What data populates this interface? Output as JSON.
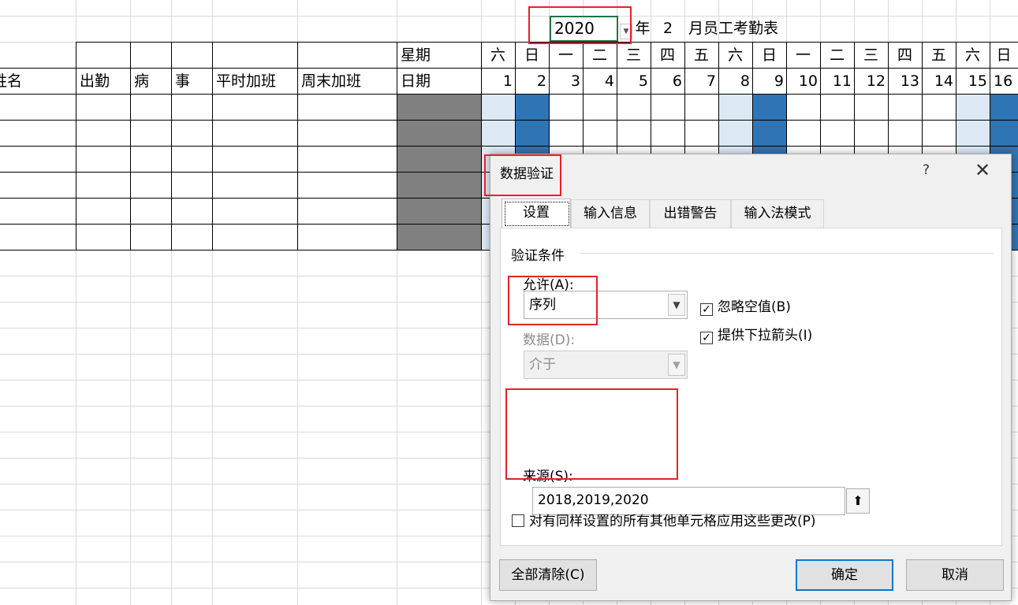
{
  "sheet": {
    "title_cells": {
      "year": "2020",
      "year_suffix": "年",
      "month": "2",
      "title": "月员工考勤表"
    },
    "header_row1": {
      "weekday_label": "星期"
    },
    "header_row2": {
      "name": "姓名",
      "attendance": "出勤",
      "sick": "病",
      "personal": "事",
      "weekday_overtime": "平时加班",
      "weekend_overtime": "周末加班",
      "date_label": "日期"
    },
    "weekdays": [
      "六",
      "日",
      "一",
      "二",
      "三",
      "四",
      "五",
      "六",
      "日",
      "一",
      "二",
      "三",
      "四",
      "五",
      "六",
      "日"
    ],
    "days": [
      "1",
      "2",
      "3",
      "4",
      "5",
      "6",
      "7",
      "8",
      "9",
      "10",
      "11",
      "12",
      "13",
      "14",
      "15",
      "16"
    ],
    "colors": {
      "saturday_fill": "#dce9f5",
      "sunday_fill": "#2e75b6",
      "weekday_col_fill": "#808080",
      "highlight": "#e8202a",
      "selected_cell_border": "#217346"
    }
  },
  "dialog": {
    "title": "数据验证",
    "help": "?",
    "close": "✕",
    "tabs": [
      "设置",
      "输入信息",
      "出错警告",
      "输入法模式"
    ],
    "group_legend": "验证条件",
    "allow_label": "允许(A):",
    "allow_value": "序列",
    "data_label": "数据(D):",
    "data_value": "介于",
    "ignore_blank": {
      "label": "忽略空值(B)",
      "checked": true
    },
    "dropdown_arrow": {
      "label": "提供下拉箭头(I)",
      "checked": true
    },
    "source_label": "来源(S):",
    "source_value": "2018,2019,2020",
    "apply_all": {
      "label": "对有同样设置的所有其他单元格应用这些更改(P)",
      "checked": false
    },
    "clear_all": "全部清除(C)",
    "ok": "确定",
    "cancel": "取消"
  }
}
